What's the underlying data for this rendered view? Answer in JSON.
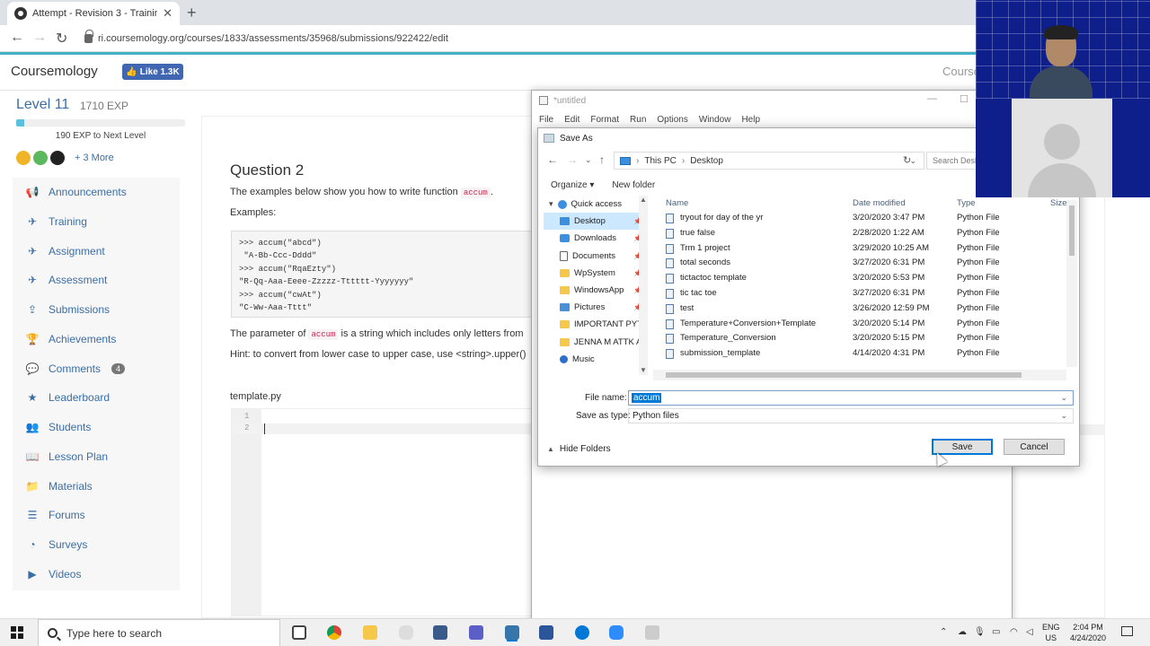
{
  "browser": {
    "tab_title": "Attempt - Revision 3 - Training -",
    "url": "ri.coursemology.org/courses/1833/assessments/35968/submissions/922422/edit"
  },
  "site": {
    "logo": "Coursemology",
    "fb_like": "Like 1.3K",
    "course_title": "Course"
  },
  "level": {
    "title": "Level 11",
    "exp": "1710 EXP",
    "progress_fraction": 0.05,
    "to_next": "190 EXP to Next Level",
    "more": "+ 3 More",
    "badge_colors": [
      "#f0b429",
      "#5cb85c",
      "#222222"
    ]
  },
  "sidebar": {
    "items": [
      {
        "label": "Announcements",
        "icon": "megaphone-icon",
        "glyph": "📢"
      },
      {
        "label": "Training",
        "icon": "plane-icon",
        "glyph": "✈"
      },
      {
        "label": "Assignment",
        "icon": "plane-icon",
        "glyph": "✈"
      },
      {
        "label": "Assessment",
        "icon": "plane-icon",
        "glyph": "✈"
      },
      {
        "label": "Submissions",
        "icon": "upload-icon",
        "glyph": "⇪"
      },
      {
        "label": "Achievements",
        "icon": "trophy-icon",
        "glyph": "🏆"
      },
      {
        "label": "Comments",
        "icon": "comments-icon",
        "glyph": "💬",
        "count": "4"
      },
      {
        "label": "Leaderboard",
        "icon": "star-icon",
        "glyph": "★"
      },
      {
        "label": "Students",
        "icon": "users-icon",
        "glyph": "👥"
      },
      {
        "label": "Lesson Plan",
        "icon": "book-icon",
        "glyph": "📖"
      },
      {
        "label": "Materials",
        "icon": "folder-icon",
        "glyph": "📁"
      },
      {
        "label": "Forums",
        "icon": "list-icon",
        "glyph": "☰"
      },
      {
        "label": "Surveys",
        "icon": "pie-chart-icon",
        "glyph": "◔"
      },
      {
        "label": "Videos",
        "icon": "video-icon",
        "glyph": "▶"
      }
    ]
  },
  "question": {
    "title": "Question 2",
    "intro_prefix": "The examples below show you how to write function",
    "intro_code": "accum",
    "intro_suffix": ".",
    "examples_label": "Examples:",
    "code_lines": [
      ">>> accum(\"abcd\")",
      " \"A-Bb-Ccc-Dddd\"",
      ">>> accum(\"RqaEzty\")",
      "\"R-Qq-Aaa-Eeee-Zzzzz-Tttttt-Yyyyyyy\"",
      ">>> accum(\"cwAt\")",
      "\"C-Ww-Aaa-Tttt\""
    ],
    "param_prefix": "The parameter of",
    "param_code": "accum",
    "param_suffix": "is a string which includes only letters from",
    "hint": "Hint: to convert from lower case to upper case, use <string>.upper()",
    "template_label": "template.py",
    "line_numbers": [
      "1",
      "2"
    ]
  },
  "notepad": {
    "title": "*untitled",
    "menu": [
      "File",
      "Edit",
      "Format",
      "Run",
      "Options",
      "Window",
      "Help"
    ]
  },
  "dialog": {
    "title": "Save As",
    "crumbs": [
      "This PC",
      "Desktop"
    ],
    "search_placeholder": "Search Desk",
    "organize": "Organize ▾",
    "new_folder": "New folder",
    "nav_items": [
      {
        "label": "Quick access",
        "kind": "star"
      },
      {
        "label": "Desktop",
        "kind": "desktop",
        "selected": true,
        "pinned": true
      },
      {
        "label": "Downloads",
        "kind": "download",
        "pinned": true
      },
      {
        "label": "Documents",
        "kind": "doc",
        "pinned": true
      },
      {
        "label": "WpSystem",
        "kind": "folder",
        "pinned": true
      },
      {
        "label": "WindowsApp",
        "kind": "folder",
        "pinned": true
      },
      {
        "label": "Pictures",
        "kind": "pictures",
        "pinned": true
      },
      {
        "label": "IMPORTANT PYT",
        "kind": "folder"
      },
      {
        "label": "JENNA M ATTK A",
        "kind": "folder"
      },
      {
        "label": "Music",
        "kind": "music"
      }
    ],
    "columns": {
      "name": "Name",
      "date": "Date modified",
      "type": "Type",
      "size": "Size"
    },
    "files": [
      {
        "name": "tryout for day of the yr",
        "date": "3/20/2020 3:47 PM",
        "type": "Python File"
      },
      {
        "name": "true false",
        "date": "2/28/2020 1:22 AM",
        "type": "Python File"
      },
      {
        "name": "Trm 1 project",
        "date": "3/29/2020 10:25 AM",
        "type": "Python File"
      },
      {
        "name": "total seconds",
        "date": "3/27/2020 6:31 PM",
        "type": "Python File"
      },
      {
        "name": "tictactoc template",
        "date": "3/20/2020 5:53 PM",
        "type": "Python File"
      },
      {
        "name": "tic tac toe",
        "date": "3/27/2020 6:31 PM",
        "type": "Python File"
      },
      {
        "name": "test",
        "date": "3/26/2020 12:59 PM",
        "type": "Python File"
      },
      {
        "name": "Temperature+Conversion+Template",
        "date": "3/20/2020 5:14 PM",
        "type": "Python File"
      },
      {
        "name": "Temperature_Conversion",
        "date": "3/20/2020 5:15 PM",
        "type": "Python File"
      },
      {
        "name": "submission_template",
        "date": "4/14/2020 4:31 PM",
        "type": "Python File"
      }
    ],
    "file_name_label": "File name:",
    "file_name_value": "accum",
    "save_type_label": "Save as type:",
    "save_type_value": "Python files",
    "hide_folders": "Hide Folders",
    "save": "Save",
    "cancel": "Cancel"
  },
  "taskbar": {
    "search_placeholder": "Type here to search",
    "lang_top": "ENG",
    "lang_bottom": "US",
    "time": "2:04 PM",
    "date": "4/24/2020"
  }
}
